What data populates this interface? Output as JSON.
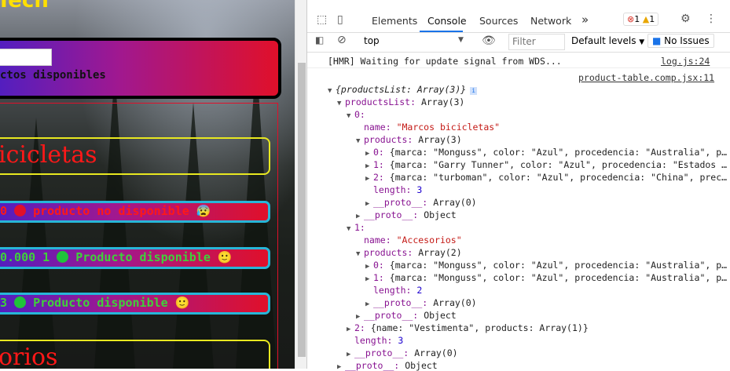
{
  "page": {
    "header_title": "Tech",
    "search_text": "ctos disponibles",
    "categories": [
      "icicletas",
      "orios"
    ],
    "rows": [
      {
        "price": "0",
        "status": "producto no disponible",
        "emoji": "😰",
        "dot_color": "#e0102a",
        "status_color": "#ff1818"
      },
      {
        "price": "0.000 1",
        "status": "Producto disponible",
        "emoji": "🙂",
        "dot_color": "#1fc43a",
        "status_color": "#3fd13a"
      },
      {
        "price": "3",
        "status": "Producto disponible",
        "emoji": "🙂",
        "dot_color": "#1fc43a",
        "status_color": "#3fd13a"
      }
    ]
  },
  "devtools": {
    "tabs": [
      "Elements",
      "Console",
      "Sources",
      "Network"
    ],
    "active_tab": "Console",
    "more_tabs": "»",
    "error_count": "1",
    "warning_count": "1",
    "context": "top",
    "filter_placeholder": "Filter",
    "levels_label": "Default levels",
    "issues_label": "No Issues",
    "messages": [
      {
        "text": "[HMR] Waiting for update signal from WDS...",
        "source": "log.js:24"
      },
      {
        "text": "",
        "source": "product-table.comp.jsx:11"
      }
    ]
  },
  "tree": [
    {
      "i": 0,
      "tri": "▼",
      "key": "",
      "val": "{productsList: Array(3)}",
      "info": true
    },
    {
      "i": 1,
      "tri": "▼",
      "key": "productsList",
      "val": "Array(3)"
    },
    {
      "i": 2,
      "tri": "▼",
      "key": "0",
      "val": ""
    },
    {
      "i": 3,
      "tri": "",
      "key": "name",
      "val": "\"Marcos bicicletas\"",
      "str": true
    },
    {
      "i": 3,
      "tri": "▼",
      "key": "products",
      "val": "Array(3)"
    },
    {
      "i": 4,
      "tri": "▶",
      "key": "0",
      "val": "{marca: \"Monguss\", color: \"Azul\", procedencia: \"Australia\", p…"
    },
    {
      "i": 4,
      "tri": "▶",
      "key": "1",
      "val": "{marca: \"Garry Tunner\", color: \"Azul\", procedencia: \"Estados …"
    },
    {
      "i": 4,
      "tri": "▶",
      "key": "2",
      "val": "{marca: \"turboman\", color: \"Azul\", procedencia: \"China\", prec…"
    },
    {
      "i": 4,
      "tri": "",
      "key": "length",
      "val": "3",
      "num": true
    },
    {
      "i": 4,
      "tri": "▶",
      "key": "__proto__",
      "val": "Array(0)"
    },
    {
      "i": 3,
      "tri": "▶",
      "key": "__proto__",
      "val": "Object"
    },
    {
      "i": 2,
      "tri": "▼",
      "key": "1",
      "val": ""
    },
    {
      "i": 3,
      "tri": "",
      "key": "name",
      "val": "\"Accesorios\"",
      "str": true
    },
    {
      "i": 3,
      "tri": "▼",
      "key": "products",
      "val": "Array(2)"
    },
    {
      "i": 4,
      "tri": "▶",
      "key": "0",
      "val": "{marca: \"Monguss\", color: \"Azul\", procedencia: \"Australia\", p…"
    },
    {
      "i": 4,
      "tri": "▶",
      "key": "1",
      "val": "{marca: \"Monguss\", color: \"Azul\", procedencia: \"Australia\", p…"
    },
    {
      "i": 4,
      "tri": "",
      "key": "length",
      "val": "2",
      "num": true
    },
    {
      "i": 4,
      "tri": "▶",
      "key": "__proto__",
      "val": "Array(0)"
    },
    {
      "i": 3,
      "tri": "▶",
      "key": "__proto__",
      "val": "Object"
    },
    {
      "i": 2,
      "tri": "▶",
      "key": "2",
      "val": "{name: \"Vestimenta\", products: Array(1)}"
    },
    {
      "i": 2,
      "tri": "",
      "key": "length",
      "val": "3",
      "num": true
    },
    {
      "i": 2,
      "tri": "▶",
      "key": "__proto__",
      "val": "Array(0)"
    },
    {
      "i": 1,
      "tri": "▶",
      "key": "__proto__",
      "val": "Object"
    }
  ]
}
